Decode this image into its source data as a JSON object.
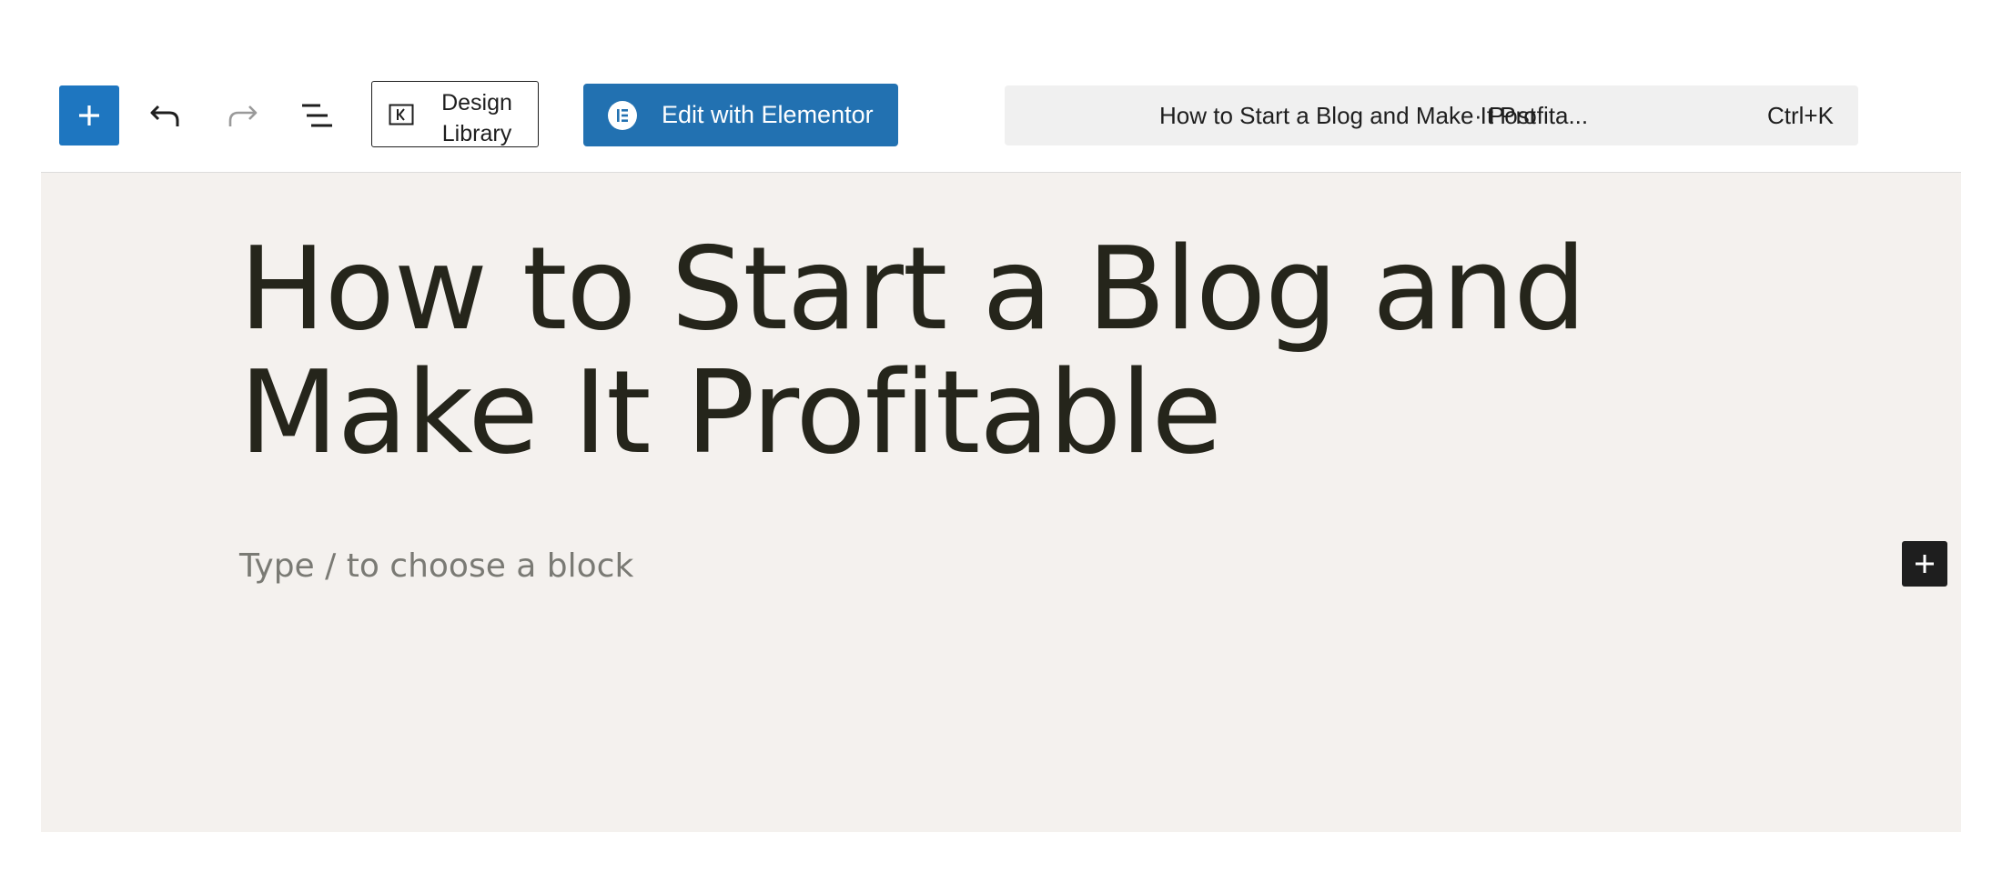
{
  "toolbar": {
    "add_block_icon": "plus-icon",
    "undo_icon": "undo-icon",
    "redo_icon": "redo-icon",
    "list_view_icon": "list-view-icon",
    "design_library_label": "Design Library",
    "design_library_icon": "kadence-library-icon",
    "elementor_label": "Edit with Elementor",
    "elementor_icon": "elementor-icon",
    "primary_color": "#1e76c0",
    "elementor_color": "#2271b1"
  },
  "document_bar": {
    "title": "How to Start a Blog and Make It Profita...",
    "post_type": "· Post",
    "shortcut": "Ctrl+K"
  },
  "editor": {
    "post_title": "How to Start a Blog and Make It Profitable",
    "block_placeholder": "Type / to choose a block",
    "inline_add_icon": "plus-icon",
    "canvas_color": "#f4f1ee"
  }
}
